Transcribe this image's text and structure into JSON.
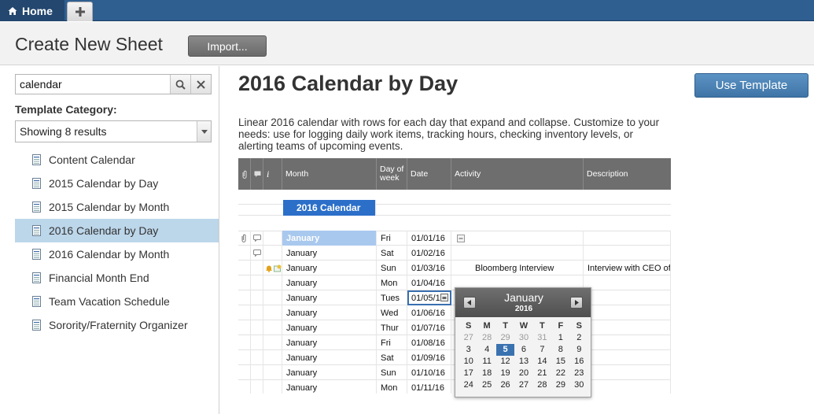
{
  "tabs": {
    "home_label": "Home"
  },
  "header": {
    "title": "Create New Sheet",
    "import_label": "Import..."
  },
  "search": {
    "value": "calendar"
  },
  "category": {
    "label": "Template Category:",
    "selected": "Showing 8 results"
  },
  "templates": [
    {
      "label": "Content Calendar",
      "selected": false
    },
    {
      "label": "2015 Calendar by Day",
      "selected": false
    },
    {
      "label": "2015 Calendar by Month",
      "selected": false
    },
    {
      "label": "2016 Calendar by Day",
      "selected": true
    },
    {
      "label": "2016 Calendar by Month",
      "selected": false
    },
    {
      "label": "Financial Month End",
      "selected": false
    },
    {
      "label": "Team Vacation Schedule",
      "selected": false
    },
    {
      "label": "Sorority/Fraternity Organizer",
      "selected": false
    }
  ],
  "detail": {
    "title": "2016 Calendar by Day",
    "use_label": "Use Template",
    "description": "Linear 2016 calendar with rows for each day that expand and collapse. Customize to your needs: use for logging daily work items, tracking hours, checking inventory levels, or alerting teams of upcoming events."
  },
  "preview": {
    "columns": [
      "",
      "",
      "i",
      "Month",
      "Day of week",
      "Date",
      "Activity",
      "Description"
    ],
    "banner": "2016 Calendar",
    "rows": [
      {
        "month": "January",
        "dow": "Fri",
        "date": "01/01/16",
        "activity": "",
        "description": ""
      },
      {
        "month": "January",
        "dow": "Sat",
        "date": "01/02/16",
        "activity": "",
        "description": ""
      },
      {
        "month": "January",
        "dow": "Sun",
        "date": "01/03/16",
        "activity": "Bloomberg Interview",
        "description": "Interview with CEO of w"
      },
      {
        "month": "January",
        "dow": "Mon",
        "date": "01/04/16",
        "activity": "",
        "description": ""
      },
      {
        "month": "January",
        "dow": "Tues",
        "date": "01/05/16",
        "activity": "",
        "description": ""
      },
      {
        "month": "January",
        "dow": "Wed",
        "date": "01/06/16",
        "activity": "",
        "description": ""
      },
      {
        "month": "January",
        "dow": "Thur",
        "date": "01/07/16",
        "activity": "",
        "description": ""
      },
      {
        "month": "January",
        "dow": "Fri",
        "date": "01/08/16",
        "activity": "",
        "description": ""
      },
      {
        "month": "January",
        "dow": "Sat",
        "date": "01/09/16",
        "activity": "",
        "description": ""
      },
      {
        "month": "January",
        "dow": "Sun",
        "date": "01/10/16",
        "activity": "",
        "description": ""
      },
      {
        "month": "January",
        "dow": "Mon",
        "date": "01/11/16",
        "activity": "",
        "description": ""
      }
    ]
  },
  "datepicker": {
    "month": "January",
    "year": "2016",
    "weekdays": [
      "S",
      "M",
      "T",
      "W",
      "T",
      "F",
      "S"
    ],
    "days": [
      [
        27,
        28,
        29,
        30,
        31,
        1,
        2
      ],
      [
        3,
        4,
        5,
        6,
        7,
        8,
        9
      ],
      [
        10,
        11,
        12,
        13,
        14,
        15,
        16
      ],
      [
        17,
        18,
        19,
        20,
        21,
        22,
        23
      ],
      [
        24,
        25,
        26,
        27,
        28,
        29,
        30
      ]
    ],
    "selected_day": 5
  }
}
